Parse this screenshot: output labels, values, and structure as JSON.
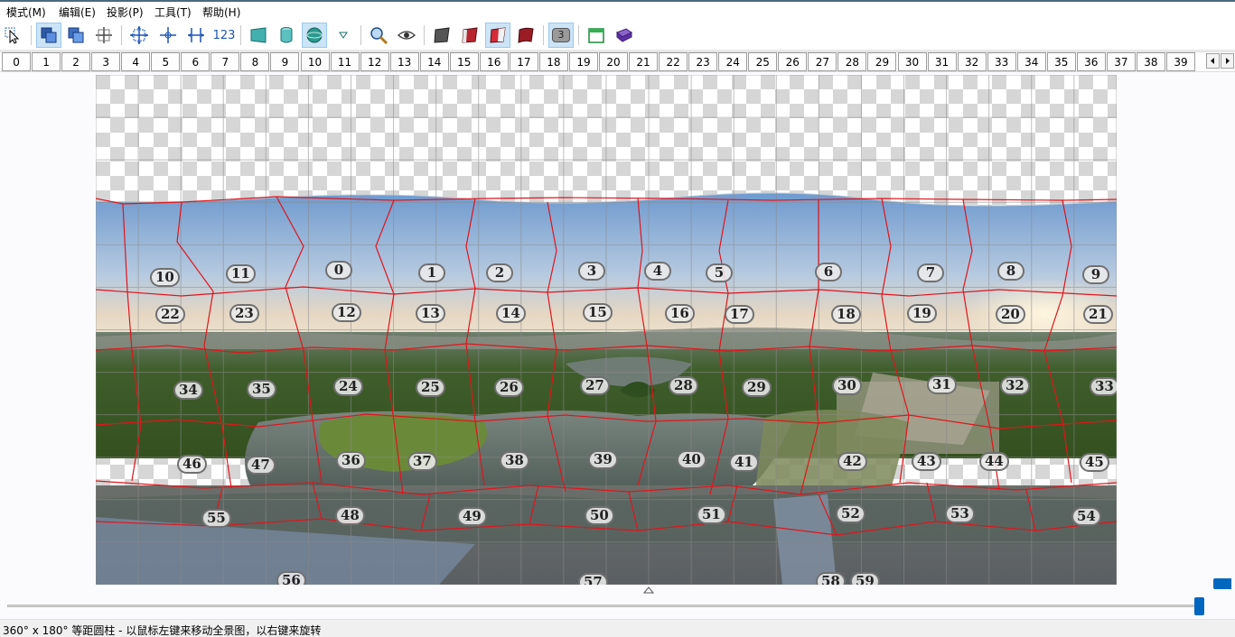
{
  "menu": {
    "items": [
      "模式(M)",
      "编辑(E)",
      "投影(P)",
      "工具(T)",
      "帮助(H)"
    ]
  },
  "toolbar": {
    "number_label": "123",
    "badge_value": "3",
    "icons": [
      "select-pointer",
      "preview-images",
      "layers",
      "crosshair",
      "fit-pano",
      "center-pano",
      "straighten",
      "numbers",
      "projection-rectilinear",
      "projection-cylinder",
      "projection-sphere",
      "projection-dropdown",
      "zoom",
      "view",
      "image-gray",
      "image-red",
      "image-red-selected",
      "image-red-curl",
      "overview",
      "gui-window",
      "help-book"
    ]
  },
  "ruler": {
    "numbers": [
      "0",
      "1",
      "2",
      "3",
      "4",
      "5",
      "6",
      "7",
      "8",
      "9",
      "10",
      "11",
      "12",
      "13",
      "14",
      "15",
      "16",
      "17",
      "18",
      "19",
      "20",
      "21",
      "22",
      "23",
      "24",
      "25",
      "26",
      "27",
      "28",
      "29",
      "30",
      "31",
      "32",
      "33",
      "34",
      "35",
      "36",
      "37",
      "38",
      "39"
    ]
  },
  "pano": {
    "labels": [
      "0",
      "1",
      "2",
      "3",
      "4",
      "5",
      "6",
      "7",
      "8",
      "9",
      "10",
      "11",
      "12",
      "13",
      "14",
      "15",
      "16",
      "17",
      "18",
      "19",
      "20",
      "21",
      "22",
      "23",
      "24",
      "25",
      "26",
      "27",
      "28",
      "29",
      "30",
      "31",
      "32",
      "33",
      "34",
      "35",
      "36",
      "37",
      "38",
      "39",
      "40",
      "41",
      "42",
      "43",
      "44",
      "45",
      "46",
      "47",
      "48",
      "49",
      "50",
      "51",
      "52",
      "53",
      "54",
      "55",
      "56",
      "57",
      "58",
      "59"
    ]
  },
  "colors": {
    "seam": "#e0151b",
    "accent": "#0067c0",
    "sky_top": "#6f9acf",
    "water": "#5e6a64",
    "vegetation": "#3f5e2c"
  },
  "status": {
    "text": "360° x 180° 等距圆柱 - 以鼠标左键来移动全景图，以右键来旋转"
  }
}
